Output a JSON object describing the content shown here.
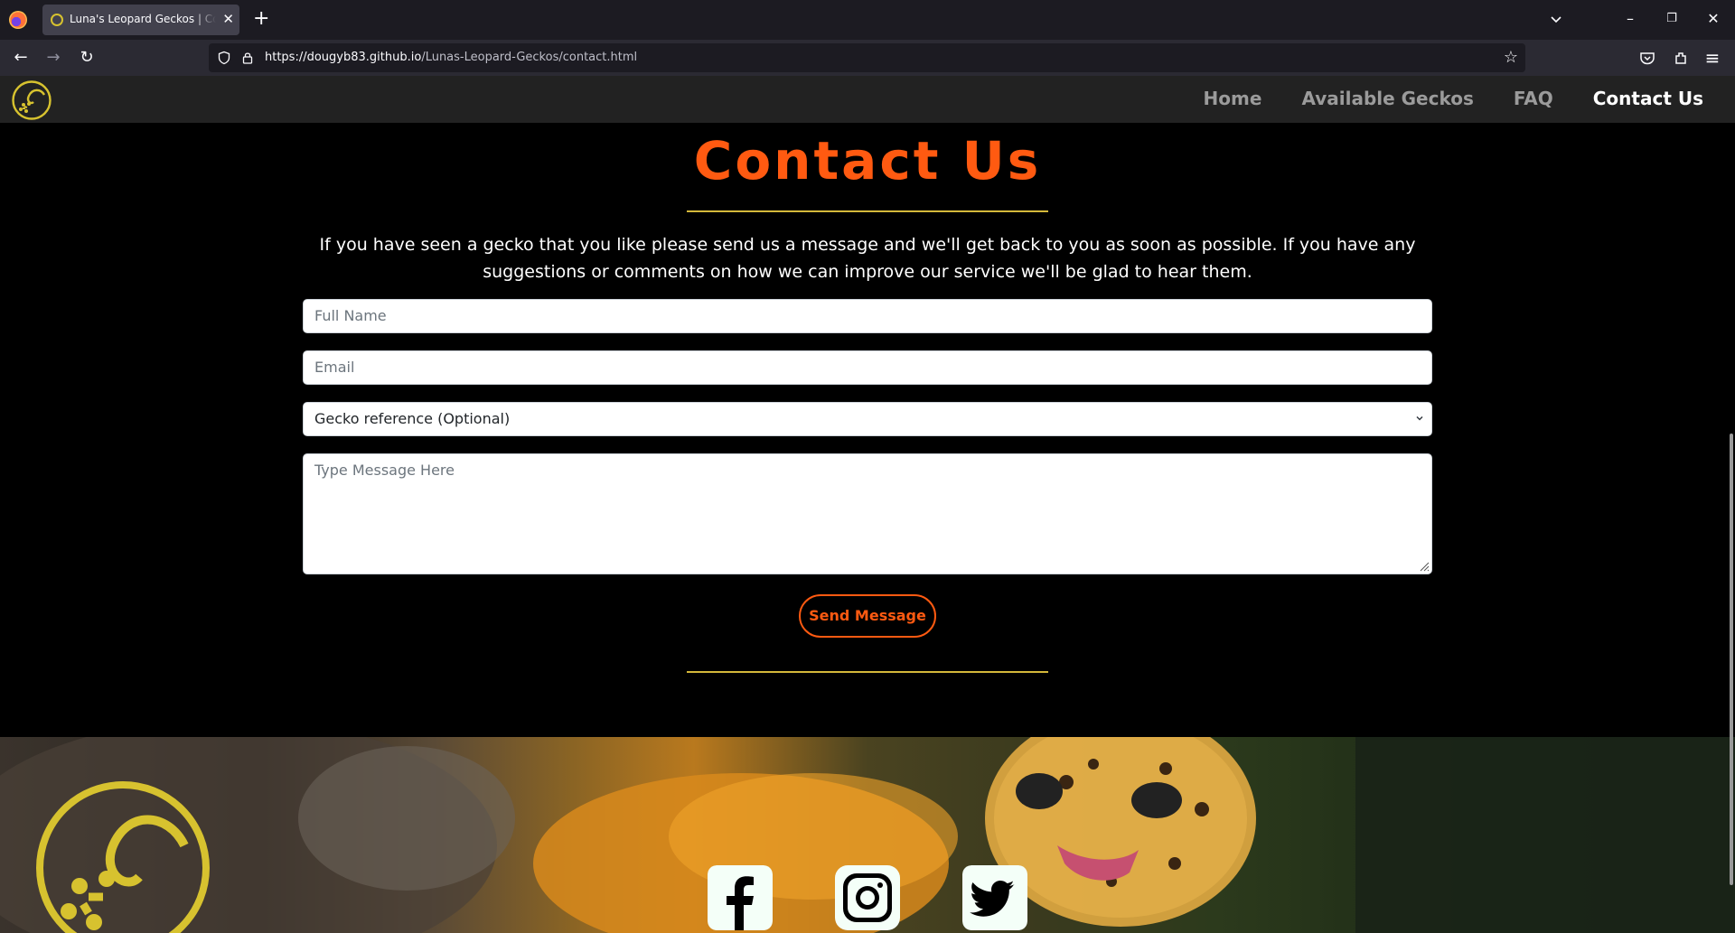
{
  "browser": {
    "tab_title": "Luna's Leopard Geckos | Contact Us",
    "tab_close": "✕",
    "new_tab": "+",
    "url_host": "https://dougyb83.github.io",
    "url_path": "/Lunas-Leopard-Geckos/contact.html",
    "back": "←",
    "forward": "→",
    "reload": "↻",
    "bookmark": "☆",
    "minimize": "–",
    "restore": "❐",
    "close": "✕",
    "menu": "≡"
  },
  "site": {
    "nav": [
      {
        "label": "Home"
      },
      {
        "label": "Available Geckos"
      },
      {
        "label": "FAQ"
      },
      {
        "label": "Contact Us",
        "active": true
      }
    ],
    "accent": "#ff5a11",
    "rule_color": "#d4b83a"
  },
  "contact": {
    "title": "Contact Us",
    "intro": "If you have seen a gecko that you like please send us a message and we'll get back to you as soon as possible. If you have any suggestions or comments on how we can improve our service we'll be glad to hear them.",
    "form": {
      "name_placeholder": "Full Name",
      "email_placeholder": "Email",
      "gecko_select": "Gecko reference (Optional)",
      "message_placeholder": "Type Message Here",
      "submit": "Send Message"
    }
  },
  "footer": {
    "social": [
      "facebook-icon",
      "instagram-icon",
      "twitter-icon"
    ]
  }
}
